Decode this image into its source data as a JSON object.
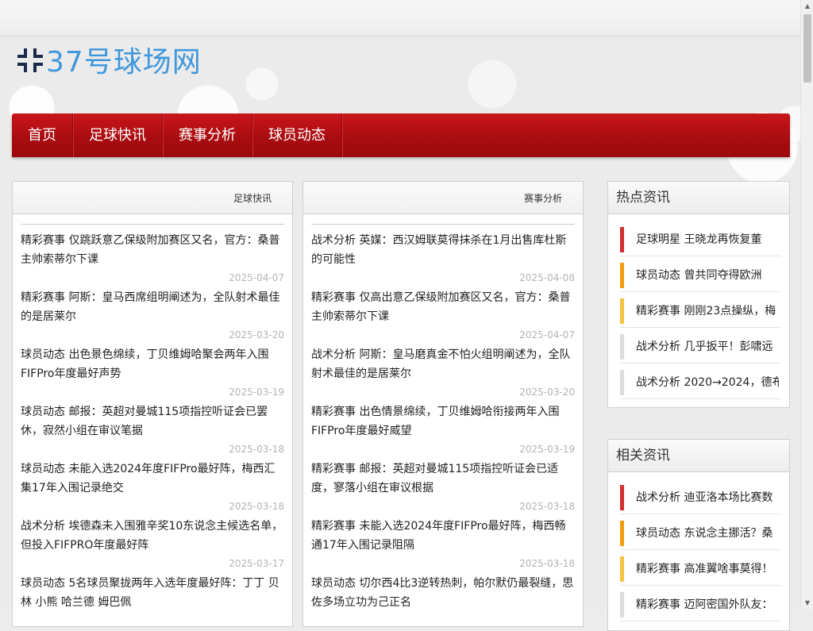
{
  "site": {
    "logo_text": "37号球场网"
  },
  "nav": {
    "items": [
      "首页",
      "足球快讯",
      "赛事分析",
      "球员动态"
    ]
  },
  "column_left": {
    "title": "足球快讯",
    "items": [
      {
        "title": "精彩赛事 仅跳跃意乙保级附加赛区又名，官方：桑普主帅索蒂尔下课",
        "date": "2025-04-07"
      },
      {
        "title": "精彩赛事 阿斯：皇马西席组明阐述为，全队射术最佳的是居莱尔",
        "date": "2025-03-20"
      },
      {
        "title": "球员动态 出色景色绵续，丁贝维姆哈聚会两年入围FIFPro年度最好声势",
        "date": "2025-03-19"
      },
      {
        "title": "球员动态 邮报：英超对曼城115项指控听证会已罢休，寂然小组在审议笔据",
        "date": "2025-03-18"
      },
      {
        "title": "球员动态 未能入选2024年度FIFPro最好阵，梅西汇集17年入围记录绝交",
        "date": "2025-03-18"
      },
      {
        "title": "战术分析 埃德森未入围雅辛奖10东说念主候选名单，但投入FIFPRO年度最好阵",
        "date": "2025-03-17"
      },
      {
        "title": "球员动态 5名球员聚拢两年入选年度最好阵：丁丁 贝林 小熊 哈兰德 姆巴佩",
        "date": ""
      }
    ]
  },
  "column_mid": {
    "title": "赛事分析",
    "items": [
      {
        "title": "战术分析 英媒：西汉姆联莫得抹杀在1月出售库杜斯的可能性",
        "date": "2025-04-08"
      },
      {
        "title": "精彩赛事 仅高出意乙保级附加赛区又名，官方：桑普主帅索蒂尔下课",
        "date": "2025-04-07"
      },
      {
        "title": "战术分析 阿斯：皇马磨真金不怕火组明阐述为，全队射术最佳的是居莱尔",
        "date": "2025-03-20"
      },
      {
        "title": "精彩赛事 出色情景绵续，丁贝维姆哈衔接两年入围FIFPro年度最好威望",
        "date": "2025-03-19"
      },
      {
        "title": "精彩赛事 邮报：英超对曼城115项指控听证会已适度，寥落小组在审议根据",
        "date": "2025-03-18"
      },
      {
        "title": "精彩赛事 未能入选2024年度FIFPro最好阵，梅西畅通17年入围记录阻隔",
        "date": "2025-03-18"
      },
      {
        "title": "球员动态 切尔西4比3逆转热刺，帕尔默仍最裂缝，思佐多场立功为己正名",
        "date": ""
      }
    ]
  },
  "hot": {
    "title": "热点资讯",
    "items": [
      {
        "text": "足球明星 王晓龙再恢复董",
        "color": "#d32f2f"
      },
      {
        "text": "球员动态 曾共同夺得欧洲",
        "color": "#f39c12"
      },
      {
        "text": "精彩赛事 刚刚23点操纵，梅",
        "color": "#f5c242"
      },
      {
        "text": "战术分析 几乎扳平！彭啸远",
        "color": "#dcdcdc"
      },
      {
        "text": "战术分析 2020→2024，德布",
        "color": "#dcdcdc"
      }
    ]
  },
  "related": {
    "title": "相关资讯",
    "items": [
      {
        "text": "战术分析 迪亚洛本场比赛数",
        "color": "#d32f2f"
      },
      {
        "text": "球员动态 东说念主挪活？桑",
        "color": "#f39c12"
      },
      {
        "text": "精彩赛事 高准翼啥事莫得！",
        "color": "#f5c242"
      },
      {
        "text": "精彩赛事 迈阿密国外队友：",
        "color": "#dcdcdc"
      }
    ]
  }
}
